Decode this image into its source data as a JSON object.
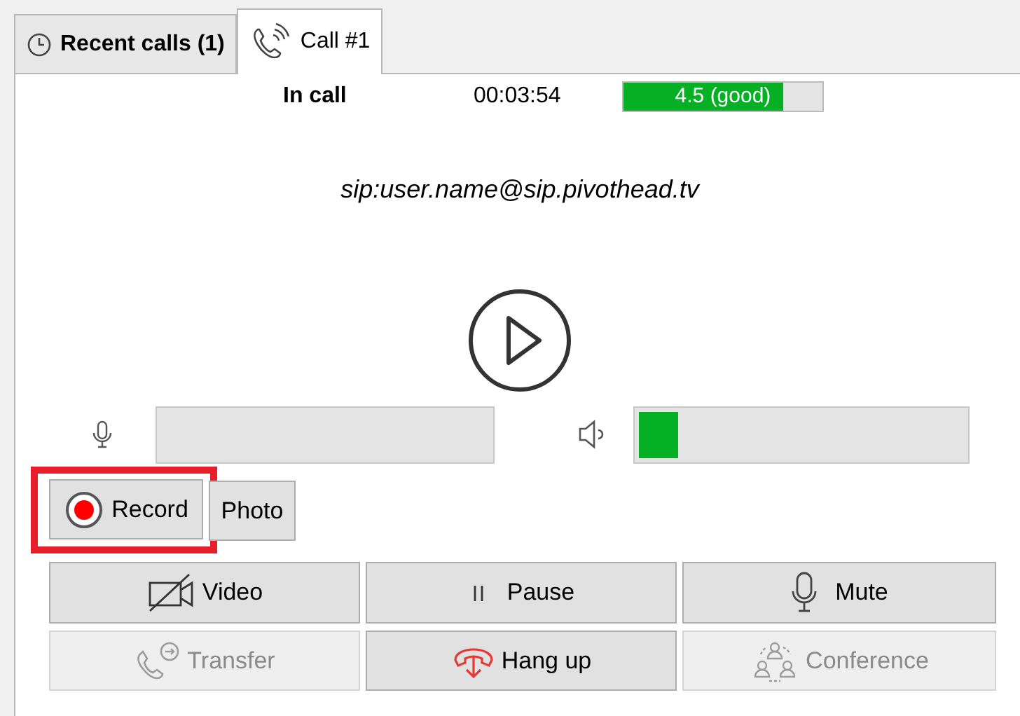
{
  "tabs": [
    {
      "label": "Recent calls (1)",
      "selected": false
    },
    {
      "label": "Call #1",
      "selected": true
    }
  ],
  "call": {
    "status": "In call",
    "duration": "00:03:54",
    "quality": {
      "label": "4.5 (good)",
      "level": 0.8
    },
    "address": "sip:user.name@sip.pivothead.tv"
  },
  "meters": [
    {
      "kind": "microphone",
      "level": 0
    },
    {
      "kind": "speaker",
      "level": 0.12
    }
  ],
  "record_button": {
    "label": "Record",
    "highlighted": true
  },
  "photo_button": {
    "label": "Photo"
  },
  "buttons": [
    {
      "label": "Video",
      "disabled": false
    },
    {
      "label": "Pause",
      "disabled": false
    },
    {
      "label": "Mute",
      "disabled": false
    },
    {
      "label": "Transfer",
      "disabled": true
    },
    {
      "label": "Hang up",
      "disabled": false
    },
    {
      "label": "Conference",
      "disabled": true
    }
  ]
}
